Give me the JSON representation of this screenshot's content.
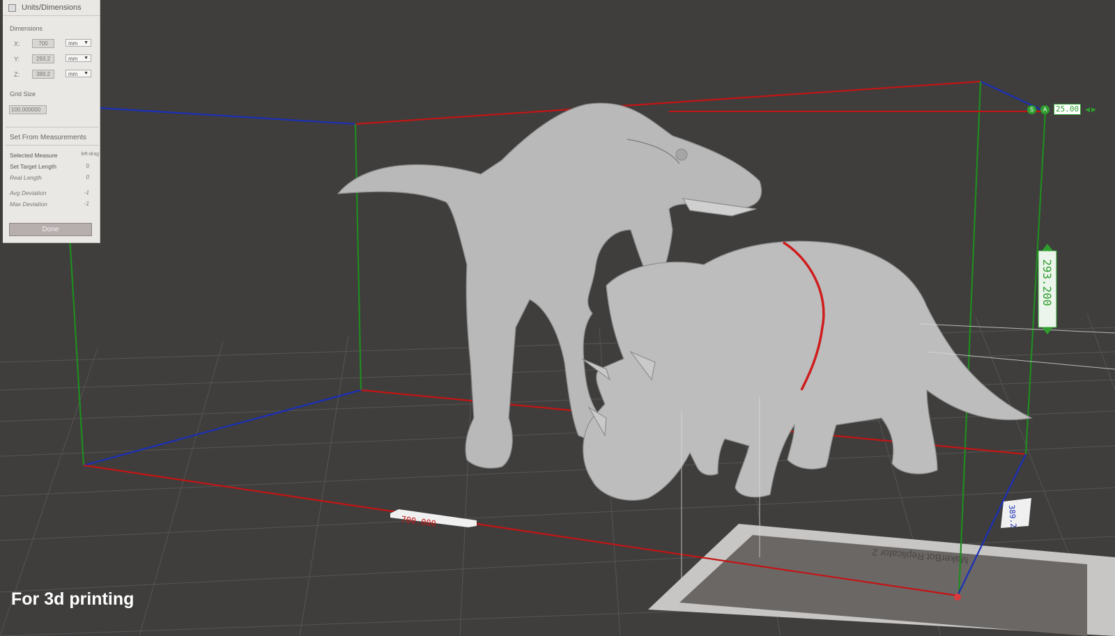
{
  "panel": {
    "title": "Units/Dimensions",
    "dimensions_label": "Dimensions",
    "x_label": "X:",
    "x_value": "700",
    "x_unit": "mm",
    "y_label": "Y:",
    "y_value": "293.2",
    "y_unit": "mm",
    "z_label": "Z:",
    "z_value": "389.2",
    "z_unit": "mm",
    "grid_size_label": "Grid Size",
    "grid_size_value": "100.000000",
    "set_from_measurements": "Set From Measurements",
    "selected_measure_label": "Selected Measure",
    "selected_measure_value": "left-drag",
    "set_target_length_label": "Set Target Length",
    "set_target_length_value": "0",
    "real_length_label": "Real Length",
    "real_length_value": "0",
    "avg_deviation_label": "Avg Deviation",
    "avg_deviation_value": "-1",
    "max_deviation_label": "Max Deviation",
    "max_deviation_value": "-1",
    "done_label": "Done"
  },
  "hud": {
    "s_label": "S",
    "a_label": "A",
    "value": "25.00"
  },
  "measurements": {
    "x_length": "700.000",
    "z_length": "293.200",
    "y_length": "389.2"
  },
  "printer_label": "MakerBot Replicator 2",
  "caption": "For 3d printing",
  "colors": {
    "background": "#3f3e3d",
    "x_axis": "#c41414",
    "y_axis": "#1a2fb8",
    "z_axis": "#1f8c1f",
    "model": "#b9b9b9",
    "hud_green": "#2f9e2f"
  },
  "icons": [
    "panel-icon",
    "arrow-left-icon",
    "arrow-right-icon",
    "dropdown-arrow-icon"
  ]
}
